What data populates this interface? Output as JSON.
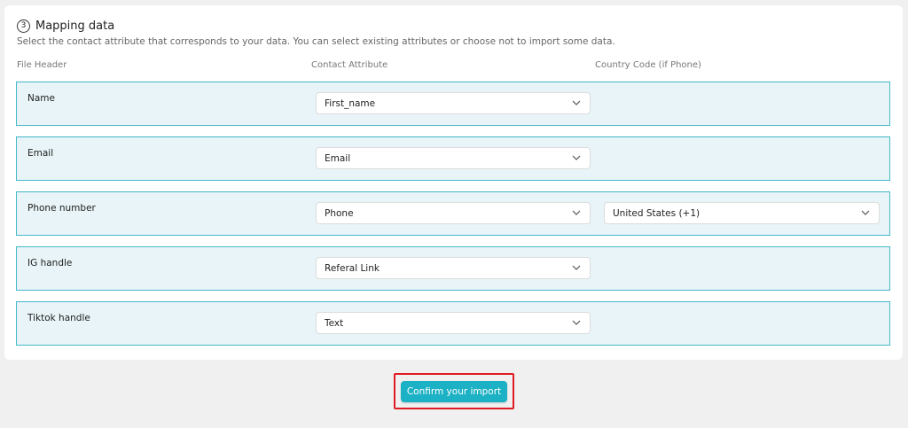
{
  "section": {
    "step_number": "3",
    "title": "Mapping data",
    "subtitle": "Select the contact attribute that corresponds to your data. You can select existing attributes or choose not to import some data."
  },
  "columns": {
    "file_header": "File Header",
    "contact_attribute": "Contact Attribute",
    "country_code": "Country Code (if Phone)"
  },
  "rows": [
    {
      "file_header": "Name",
      "contact_attribute": "First_name",
      "country_code": ""
    },
    {
      "file_header": "Email",
      "contact_attribute": "Email",
      "country_code": ""
    },
    {
      "file_header": "Phone number",
      "contact_attribute": "Phone",
      "country_code": "United States (+1)"
    },
    {
      "file_header": "IG handle",
      "contact_attribute": "Referal Link",
      "country_code": ""
    },
    {
      "file_header": "Tiktok handle",
      "contact_attribute": "Text",
      "country_code": ""
    }
  ],
  "actions": {
    "confirm_label": "Confirm your import"
  },
  "colors": {
    "row_background": "#e8f4f7",
    "row_border": "#44b9c9",
    "primary_button": "#1cb1c4",
    "highlight_outline": "#e01b24"
  },
  "icons": {
    "step": "circled-number-icon",
    "dropdown": "chevron-down-icon"
  }
}
